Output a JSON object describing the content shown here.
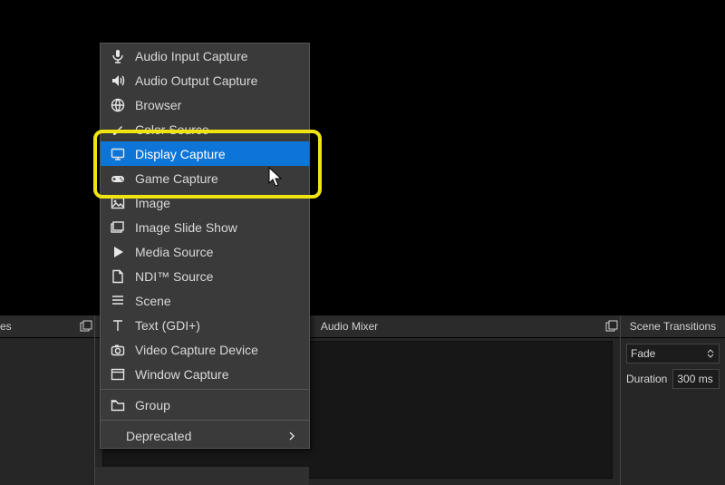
{
  "menu": {
    "items": [
      {
        "id": "audio-input",
        "label": "Audio Input Capture",
        "icon": "mic"
      },
      {
        "id": "audio-output",
        "label": "Audio Output Capture",
        "icon": "speaker"
      },
      {
        "id": "browser",
        "label": "Browser",
        "icon": "globe"
      },
      {
        "id": "color-source",
        "label": "Color Source",
        "icon": "brush"
      },
      {
        "id": "display-capture",
        "label": "Display Capture",
        "icon": "monitor",
        "hover": true
      },
      {
        "id": "game-capture",
        "label": "Game Capture",
        "icon": "gamepad"
      },
      {
        "id": "image",
        "label": "Image",
        "icon": "image"
      },
      {
        "id": "image-slide",
        "label": "Image Slide Show",
        "icon": "slides"
      },
      {
        "id": "media-source",
        "label": "Media Source",
        "icon": "play"
      },
      {
        "id": "ndi-source",
        "label": "NDI™ Source",
        "icon": "file"
      },
      {
        "id": "scene",
        "label": "Scene",
        "icon": "list"
      },
      {
        "id": "text-gdi",
        "label": "Text (GDI+)",
        "icon": "text"
      },
      {
        "id": "video-capture",
        "label": "Video Capture Device",
        "icon": "camera"
      },
      {
        "id": "window-capture",
        "label": "Window Capture",
        "icon": "window"
      }
    ],
    "group_label": "Group",
    "deprecated_label": "Deprecated"
  },
  "panels": {
    "sources_header": "es",
    "mixer_header": "Audio Mixer",
    "transitions_header": "Scene Transitions",
    "transition_selected": "Fade",
    "duration_label": "Duration",
    "duration_value": "300 ms"
  }
}
